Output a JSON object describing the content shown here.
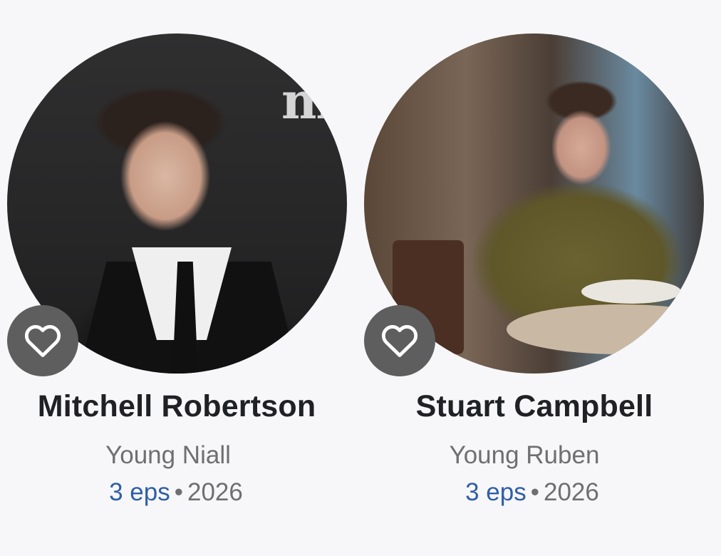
{
  "cast": [
    {
      "name": "Mitchell Robertson",
      "role": "Young Niall",
      "episodes": "3 eps",
      "separator": "•",
      "year": "2026",
      "favorite_icon": "heart-outline-icon"
    },
    {
      "name": "Stuart Campbell",
      "role": "Young Ruben",
      "episodes": "3 eps",
      "separator": "•",
      "year": "2026",
      "favorite_icon": "heart-outline-icon"
    }
  ],
  "colors": {
    "background": "#f7f7f9",
    "name": "#202124",
    "secondary_text": "#6f6f73",
    "link": "#2f5ea8",
    "favorite_button": "#5e5e5e"
  }
}
